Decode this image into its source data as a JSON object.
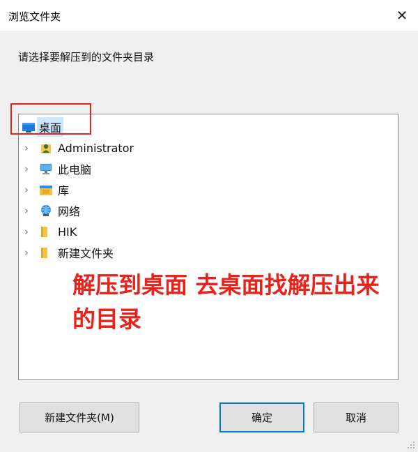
{
  "window": {
    "title": "浏览文件夹",
    "close_glyph": "✕"
  },
  "prompt": "请选择要解压到的文件夹目录",
  "tree": {
    "root": {
      "label": "桌面",
      "icon": "desktop-icon",
      "selected": true
    },
    "items": [
      {
        "label": "Administrator",
        "icon": "user-folder-icon"
      },
      {
        "label": "此电脑",
        "icon": "computer-icon"
      },
      {
        "label": "库",
        "icon": "library-icon"
      },
      {
        "label": "网络",
        "icon": "network-icon"
      },
      {
        "label": "HIK",
        "icon": "folder-icon"
      },
      {
        "label": "新建文件夹",
        "icon": "folder-icon"
      }
    ],
    "expand_glyph": "›"
  },
  "annotation": {
    "text": "解压到桌面 去桌面找解压出来的目录",
    "color": "#e8231b"
  },
  "buttons": {
    "new_folder": "新建文件夹(M)",
    "ok": "确定",
    "cancel": "取消"
  },
  "colors": {
    "accent": "#0078d7",
    "selection": "#cce8ff",
    "annotation_red": "#e8231b"
  }
}
